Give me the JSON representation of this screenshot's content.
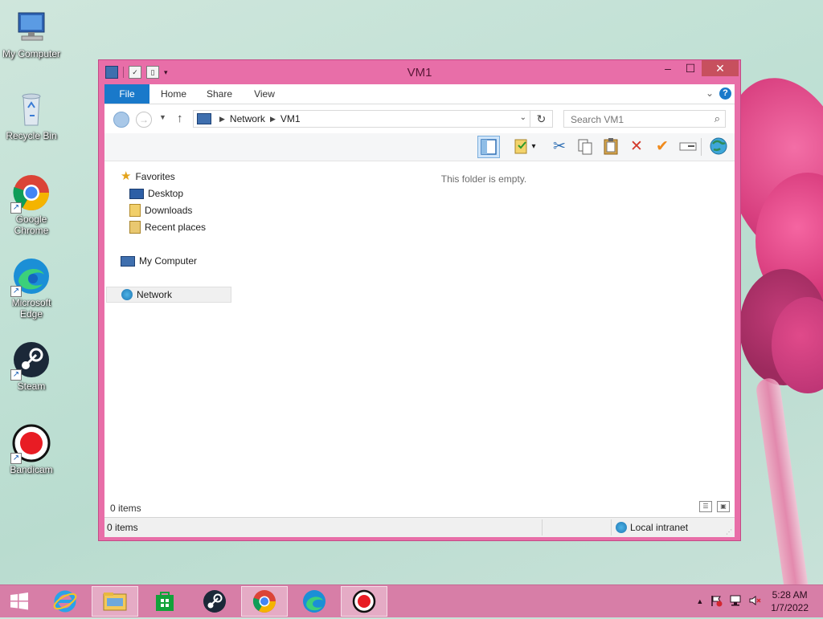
{
  "desktop": {
    "icons": [
      {
        "label": "My Computer"
      },
      {
        "label": "Recycle Bin"
      },
      {
        "label": "Google Chrome"
      },
      {
        "label": "Microsoft Edge"
      },
      {
        "label": "Steam"
      },
      {
        "label": "Bandicam"
      }
    ]
  },
  "window": {
    "title": "VM1",
    "ribbon": {
      "file": "File",
      "home": "Home",
      "share": "Share",
      "view": "View",
      "help": "?"
    },
    "address": {
      "segment1": "Network",
      "segment2": "VM1"
    },
    "search": {
      "placeholder": "Search VM1"
    },
    "nav": {
      "favorites": "Favorites",
      "desktop": "Desktop",
      "downloads": "Downloads",
      "recent": "Recent places",
      "computer": "My Computer",
      "network": "Network"
    },
    "content": {
      "empty_message": "This folder is empty."
    },
    "item_count": "0 items",
    "status": {
      "items": "0 items",
      "zone": "Local intranet"
    }
  },
  "taskbar": {
    "time": "5:28 AM",
    "date": "1/7/2022"
  },
  "colors": {
    "accent": "#1979ca",
    "window_frame": "#e86ea8",
    "taskbar": "#d77ea7"
  }
}
